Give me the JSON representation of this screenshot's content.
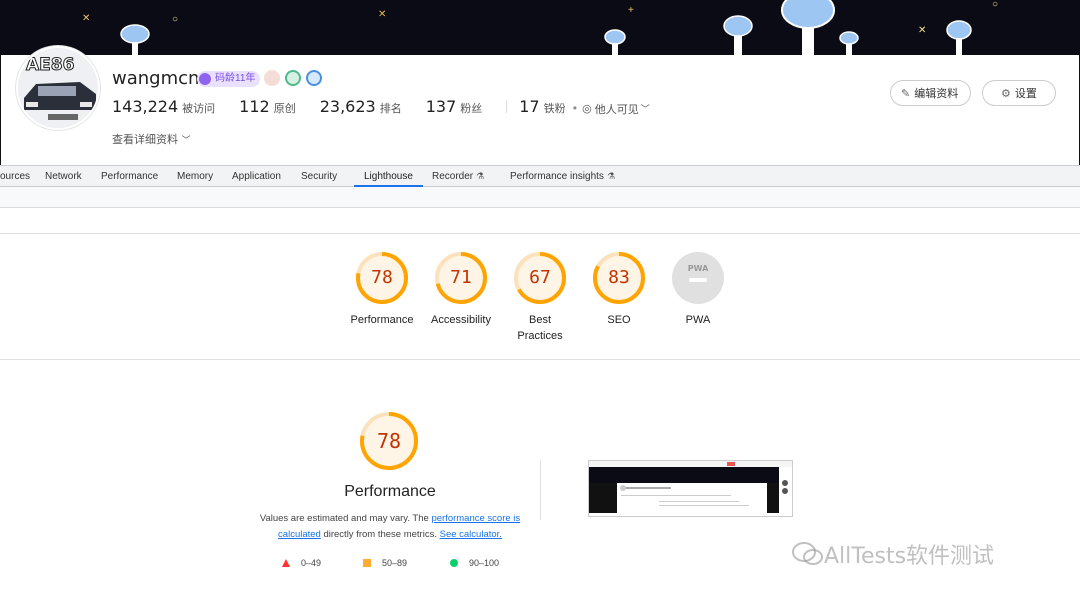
{
  "profile": {
    "username": "wangmcn",
    "age_badge": "码龄11年",
    "stats": [
      {
        "num": "143,224",
        "label": "被访问"
      },
      {
        "num": "112",
        "label": "原创"
      },
      {
        "num": "23,623",
        "label": "排名"
      },
      {
        "num": "137",
        "label": "粉丝"
      },
      {
        "num": "17",
        "label": "铁粉"
      }
    ],
    "visibility": "他人可见",
    "detail_link": "查看详细资料",
    "edit_button": "编辑资料",
    "settings_button": "设置"
  },
  "devtools": {
    "tabs": [
      {
        "label": "ources"
      },
      {
        "label": "Network"
      },
      {
        "label": "Performance"
      },
      {
        "label": "Memory"
      },
      {
        "label": "Application"
      },
      {
        "label": "Security"
      },
      {
        "label": "Lighthouse"
      },
      {
        "label": "Recorder"
      },
      {
        "label": "Performance insights"
      }
    ],
    "active_tab": "Lighthouse"
  },
  "lighthouse": {
    "categories": [
      {
        "name": "Performance",
        "score": "78",
        "value": 78
      },
      {
        "name": "Accessibility",
        "score": "71",
        "value": 71
      },
      {
        "name": "Best Practices",
        "line1": "Best",
        "line2": "Practices",
        "score": "67",
        "value": 67
      },
      {
        "name": "SEO",
        "score": "83",
        "value": 83
      },
      {
        "name": "PWA",
        "score": "",
        "value": 0
      }
    ],
    "performance": {
      "score": "78",
      "value": 78,
      "title": "Performance",
      "note_pre": "Values are estimated and may vary. The",
      "note_link1": "performance score is calculated",
      "note_mid": "directly from these metrics.",
      "note_link2": "See calculator."
    },
    "legend": [
      {
        "range": "0–49",
        "color": "#ff3333",
        "shape": "triangle"
      },
      {
        "range": "50–89",
        "color": "#ffaa33",
        "shape": "square"
      },
      {
        "range": "90–100",
        "color": "#0cce6b",
        "shape": "circle"
      }
    ],
    "colors": {
      "average_stroke": "#ffa400",
      "average_fill": "#fff5e6",
      "average_text": "#c33300",
      "pwa_gray": "#e0e0e0"
    }
  },
  "watermark": "AllTests软件测试"
}
